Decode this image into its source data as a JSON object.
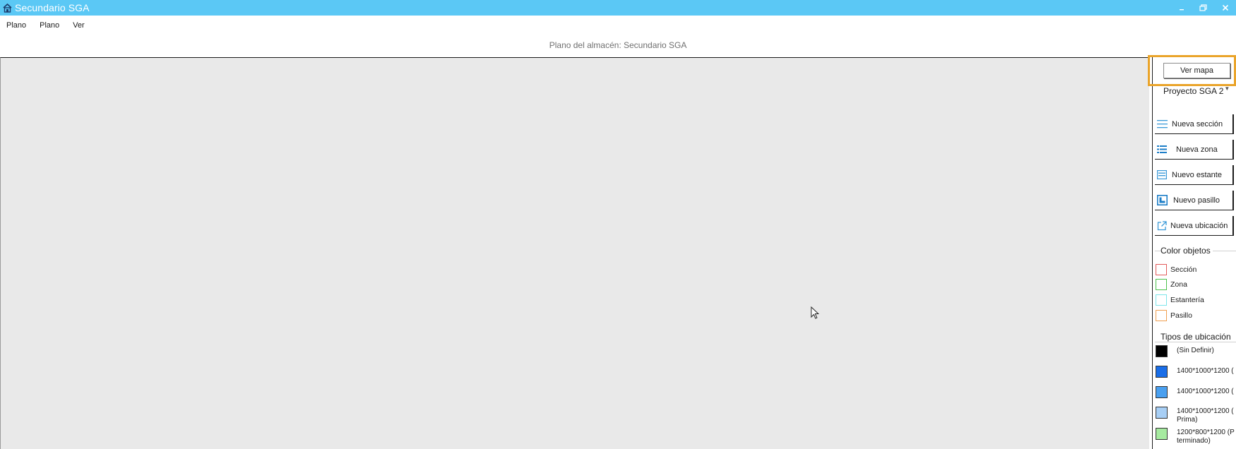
{
  "window": {
    "title": "Secundario SGA"
  },
  "menu": [
    {
      "label": "Plano"
    },
    {
      "label": "Plano"
    },
    {
      "label": "Ver"
    }
  ],
  "plan_caption": "Plano del almacén: Secundario SGA",
  "panel": {
    "ver_mapa": "Ver mapa",
    "project": "Proyecto SGA 2",
    "actions": [
      {
        "label": "Nueva sección",
        "icon": "section-lines-icon"
      },
      {
        "label": "Nueva zona",
        "icon": "zone-list-icon"
      },
      {
        "label": "Nuevo estante",
        "icon": "shelf-icon"
      },
      {
        "label": "Nuevo pasillo",
        "icon": "aisle-icon"
      },
      {
        "label": "Nueva ubicación",
        "icon": "external-link-icon"
      }
    ],
    "color_objetos": {
      "title": "Color objetos",
      "items": [
        {
          "label": "Sección",
          "color": "#e25a5a"
        },
        {
          "label": "Zona",
          "color": "#4cc24c"
        },
        {
          "label": "Estantería",
          "color": "#7ee6ea"
        },
        {
          "label": "Pasillo",
          "color": "#f0a050"
        }
      ]
    },
    "tipos_ubicacion": {
      "title": "Tipos de ubicación",
      "items": [
        {
          "line1": "(Sin Definir)",
          "line2": "",
          "color": "#000000"
        },
        {
          "line1": "1400*1000*1200 (",
          "line2": "",
          "color": "#1a6ee8"
        },
        {
          "line1": "1400*1000*1200 (",
          "line2": "",
          "color": "#4aa0f0"
        },
        {
          "line1": "1400*1000*1200 (",
          "line2": "Prima)",
          "color": "#a8cff5"
        },
        {
          "line1": "1200*800*1200 (P",
          "line2": "terminado)",
          "color": "#a6eaa0"
        }
      ]
    }
  }
}
